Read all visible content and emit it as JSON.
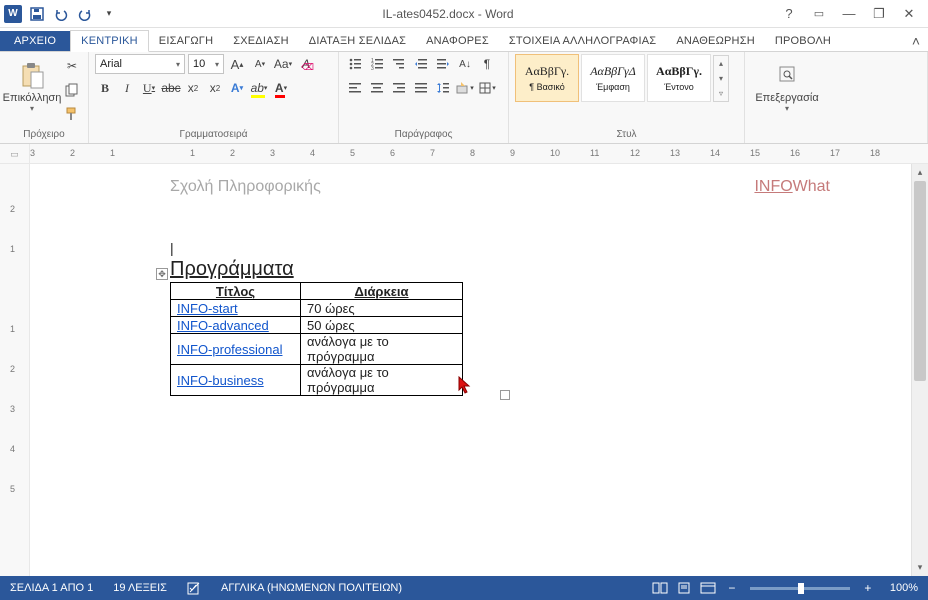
{
  "titlebar": {
    "title": "IL-ates0452.docx - Word"
  },
  "tabs": {
    "file": "ΑΡΧΕΙΟ",
    "home": "ΚΕΝΤΡΙΚΗ",
    "insert": "ΕΙΣΑΓΩΓΗ",
    "design": "ΣΧΕΔΙΑΣΗ",
    "layout": "ΔΙΑΤΑΞΗ ΣΕΛΙΔΑΣ",
    "references": "ΑΝΑΦΟΡΕΣ",
    "mailings": "ΣΤΟΙΧΕΙΑ ΑΛΛΗΛΟΓΡΑΦΙΑΣ",
    "review": "ΑΝΑΘΕΩΡΗΣΗ",
    "view": "ΠΡΟΒΟΛΗ"
  },
  "ribbon": {
    "clipboard": {
      "paste": "Επικόλληση",
      "label": "Πρόχειρο"
    },
    "font": {
      "name": "Arial",
      "size": "10",
      "label": "Γραμματοσειρά"
    },
    "paragraph": {
      "label": "Παράγραφος"
    },
    "styles": {
      "s1": {
        "preview": "ΑαΒβΓγ.",
        "name": "¶ Βασικό"
      },
      "s2": {
        "preview": "ΑαΒβΓγΔ",
        "name": "Έμφαση"
      },
      "s3": {
        "preview": "ΑαΒβΓγ.",
        "name": "Έντονο"
      },
      "label": "Στυλ"
    },
    "editing": {
      "label": "Επεξεργασία"
    }
  },
  "doc": {
    "header_left": "Σχολή Πληροφορικής",
    "header_right_a": "INFO",
    "header_right_b": "What",
    "heading": "Προγράμματα",
    "th1": "Τίτλος",
    "th2": "Διάρκεια",
    "r1c1": "INFO-start",
    "r1c2": "70 ώρες",
    "r2c1": "INFO-advanced",
    "r2c2": "50 ώρες",
    "r3c1": "INFO-professional",
    "r3c2": "ανάλογα με το πρόγραμμα",
    "r4c1": "INFO-business",
    "r4c2": "ανάλογα με το πρόγραμμα"
  },
  "status": {
    "page": "ΣΕΛΙΔΑ 1 ΑΠΟ 1",
    "words": "19 ΛΕΞΕΙΣ",
    "lang": "ΑΓΓΛΙΚΑ (ΗΝΩΜΕΝΩΝ ΠΟΛΙΤΕΙΩΝ)",
    "zoom": "100%"
  },
  "ruler_h": [
    "3",
    "2",
    "1",
    "",
    "1",
    "2",
    "3",
    "4",
    "5",
    "6",
    "7",
    "8",
    "9",
    "10",
    "11",
    "12",
    "13",
    "14",
    "15",
    "16",
    "17",
    "18"
  ],
  "ruler_v": [
    "",
    "2",
    "1",
    "",
    "1",
    "2",
    "3",
    "4",
    "5"
  ]
}
